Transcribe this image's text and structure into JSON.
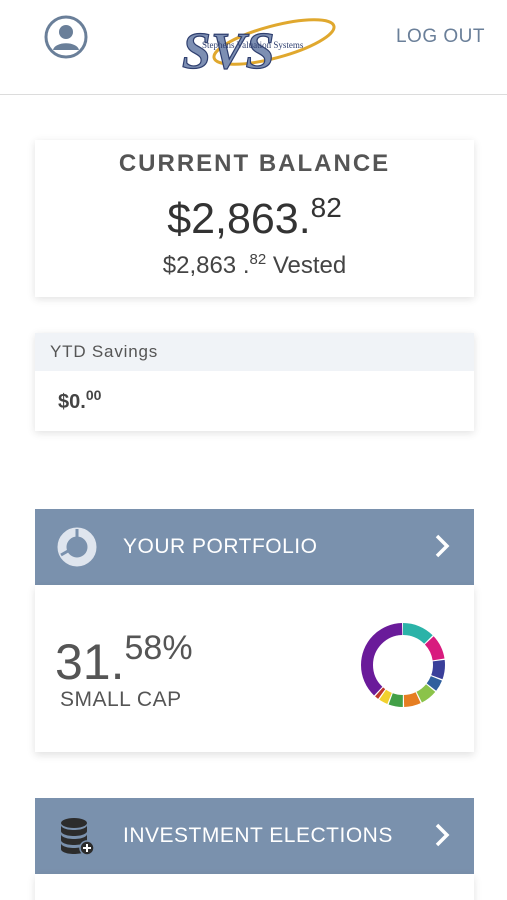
{
  "header": {
    "profile_icon": "user-circle-icon",
    "logo_text": "SVS",
    "logo_subtext": "Stephens Valuation Systems",
    "logout_label": "LOG OUT"
  },
  "balance": {
    "title": "CURRENT BALANCE",
    "amount_whole": "$2,863.",
    "amount_cents": "82",
    "vested_whole": "$2,863 .",
    "vested_cents": "82",
    "vested_label": " Vested"
  },
  "ytd": {
    "title": "YTD Savings",
    "value_whole": "$0.",
    "value_cents": "00"
  },
  "portfolio": {
    "title": "YOUR PORTFOLIO",
    "icon": "pie-chart-icon",
    "percent_whole": "31.",
    "percent_frac": "58%",
    "category": "SMALL CAP",
    "segments": [
      {
        "color": "#2bb3a8",
        "fraction": 0.13
      },
      {
        "color": "#d81b7e",
        "fraction": 0.1
      },
      {
        "color": "#3a3f9a",
        "fraction": 0.08
      },
      {
        "color": "#2f5f9e",
        "fraction": 0.05
      },
      {
        "color": "#8bc34a",
        "fraction": 0.07
      },
      {
        "color": "#e67e22",
        "fraction": 0.07
      },
      {
        "color": "#43a047",
        "fraction": 0.06
      },
      {
        "color": "#f2d12e",
        "fraction": 0.04
      },
      {
        "color": "#c0392b",
        "fraction": 0.02
      },
      {
        "color": "#6a1b9a",
        "fraction": 0.38
      }
    ]
  },
  "elections": {
    "title": "INVESTMENT ELECTIONS",
    "icon": "database-plus-icon"
  },
  "colors": {
    "accent": "#7a91ad",
    "header_link": "#6a7f99"
  }
}
